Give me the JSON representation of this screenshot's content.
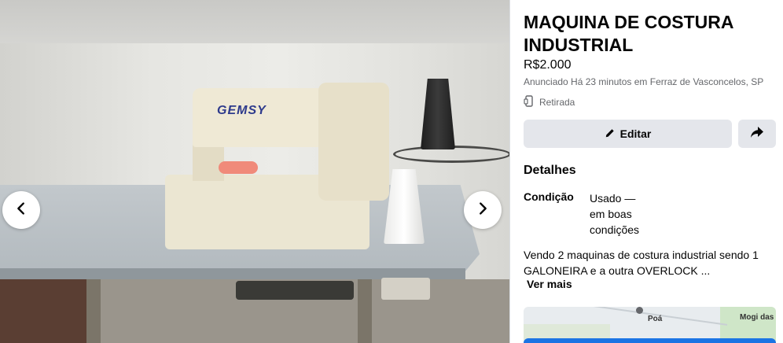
{
  "listing": {
    "title": "MAQUINA DE COSTURA INDUSTRIAL",
    "price": "R$2.000",
    "listed_info": "Anunciado Há 23 minutos em Ferraz de Vasconcelos, SP",
    "pickup": "Retirada"
  },
  "actions": {
    "edit_label": "Editar",
    "share_icon": "share-arrow-icon",
    "edit_icon": "pencil-icon"
  },
  "details": {
    "heading": "Detalhes",
    "condition_label": "Condição",
    "condition_value": "Usado — em boas condições",
    "description": "Vendo 2 maquinas de costura industrial  sendo 1 GALONEIRA e a outra OVERLOCK ...",
    "see_more": "Ver mais"
  },
  "map": {
    "label_poa": "Poá",
    "label_mogi": "Mogi das"
  },
  "viewer": {
    "photo_brand_text": "GEMSY",
    "prev_icon": "chevron-left-icon",
    "next_icon": "chevron-right-icon"
  },
  "colors": {
    "button_bg": "#e4e6eb",
    "secondary_text": "#65676b",
    "primary_blue": "#1b74e4"
  }
}
